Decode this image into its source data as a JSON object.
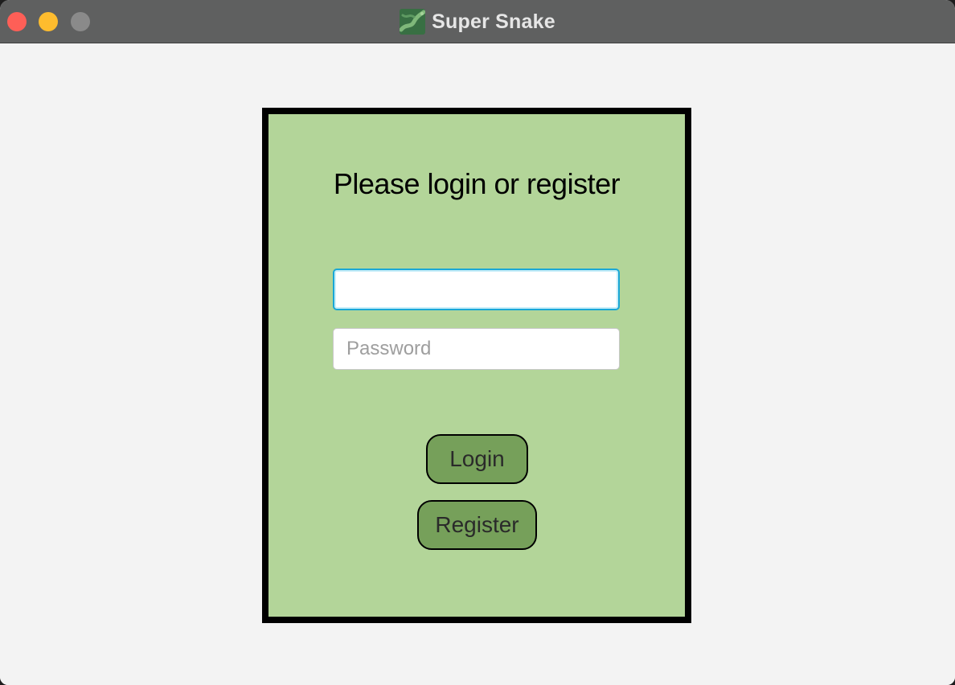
{
  "window": {
    "title": "Super Snake",
    "app_icon": "snake-app-icon"
  },
  "login_form": {
    "heading": "Please login or register",
    "username": {
      "value": "",
      "placeholder": ""
    },
    "password": {
      "value": "",
      "placeholder": "Password"
    },
    "login_label": "Login",
    "register_label": "Register"
  },
  "colors": {
    "panel_background": "#b3d599",
    "button_background": "#76a05a",
    "focus_ring": "#1aa7d6",
    "close_button": "#fe5f57",
    "minimize_button": "#febc2e",
    "zoom_button": "#8a8a8a"
  }
}
